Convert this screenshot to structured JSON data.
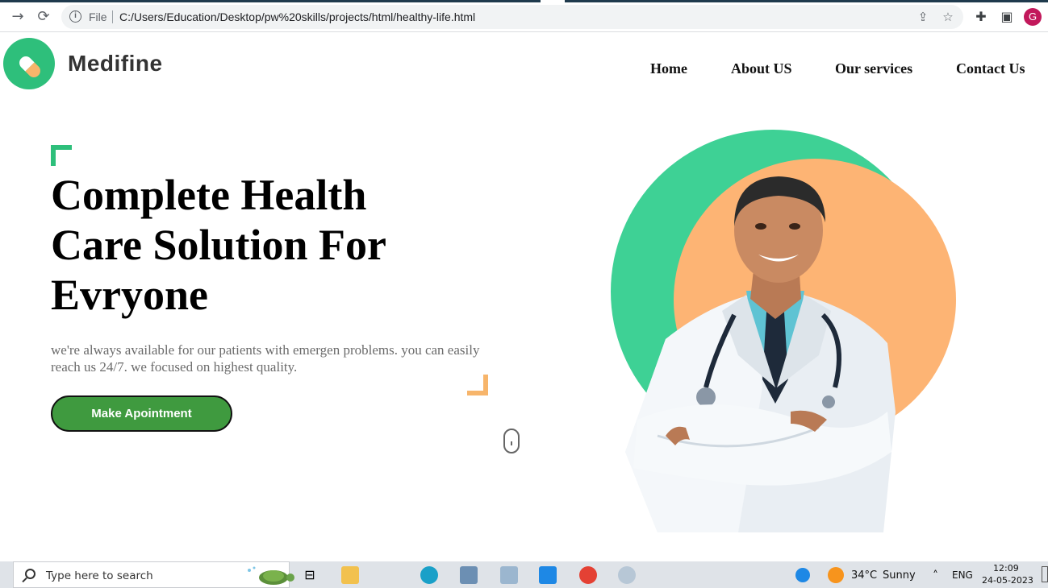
{
  "browser": {
    "file_label": "File",
    "url": "C:/Users/Education/Desktop/pw%20skills/projects/html/healthy-life.html",
    "profile_initial": "G"
  },
  "site": {
    "brand": "Medifine",
    "menu": [
      "Home",
      "About US",
      "Our services",
      "Contact Us"
    ]
  },
  "hero": {
    "title_lines": [
      "Complete Health",
      "Care Solution For",
      "Evryone"
    ],
    "description": "we're always available for our patients with emergen problems. you can easily reach us 24/7. we focused on highest quality.",
    "cta_label": "Make Apointment"
  },
  "taskbar": {
    "search_placeholder": "Type here to search",
    "weather_temp": "34°C",
    "weather_desc": "Sunny",
    "language": "ENG",
    "time": "12:09",
    "date": "24-05-2023"
  },
  "colors": {
    "accent_green": "#2ebf7b",
    "accent_orange": "#f7b56b",
    "button_green": "#3f9a3f"
  }
}
